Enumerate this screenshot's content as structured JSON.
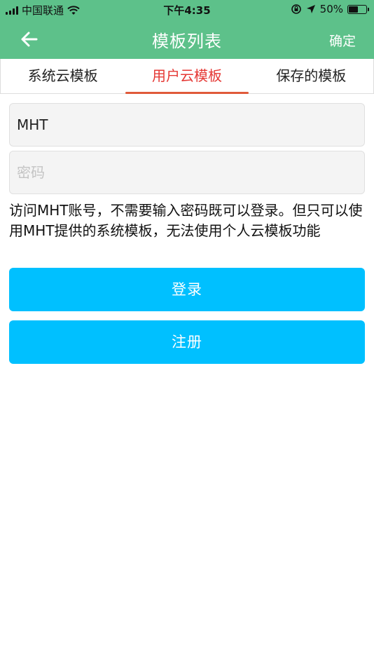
{
  "statusbar": {
    "carrier": "中国联通",
    "time": "下午4:35",
    "battery_text": "50%",
    "battery_level": 0.5,
    "icons": [
      "signal-icon",
      "wifi-icon",
      "orientation-lock-icon",
      "location-icon",
      "battery-icon"
    ]
  },
  "navbar": {
    "back_icon": "back-arrow-icon",
    "title": "模板列表",
    "confirm_label": "确定"
  },
  "tabs": [
    {
      "label": "系统云模板",
      "active": false
    },
    {
      "label": "用户云模板",
      "active": true
    },
    {
      "label": "保存的模板",
      "active": false
    }
  ],
  "form": {
    "username_value": "MHT",
    "password_placeholder": "密码",
    "hint": "访问MHT账号，不需要输入密码既可以登录。但只可以使用MHT提供的系统模板，无法使用个人云模板功能",
    "login_label": "登录",
    "register_label": "注册"
  },
  "colors": {
    "header_bg": "#5dc18a",
    "active_tab_text": "#e53935",
    "active_tab_indicator": "#e05a3a",
    "button_bg": "#00c0ff"
  }
}
